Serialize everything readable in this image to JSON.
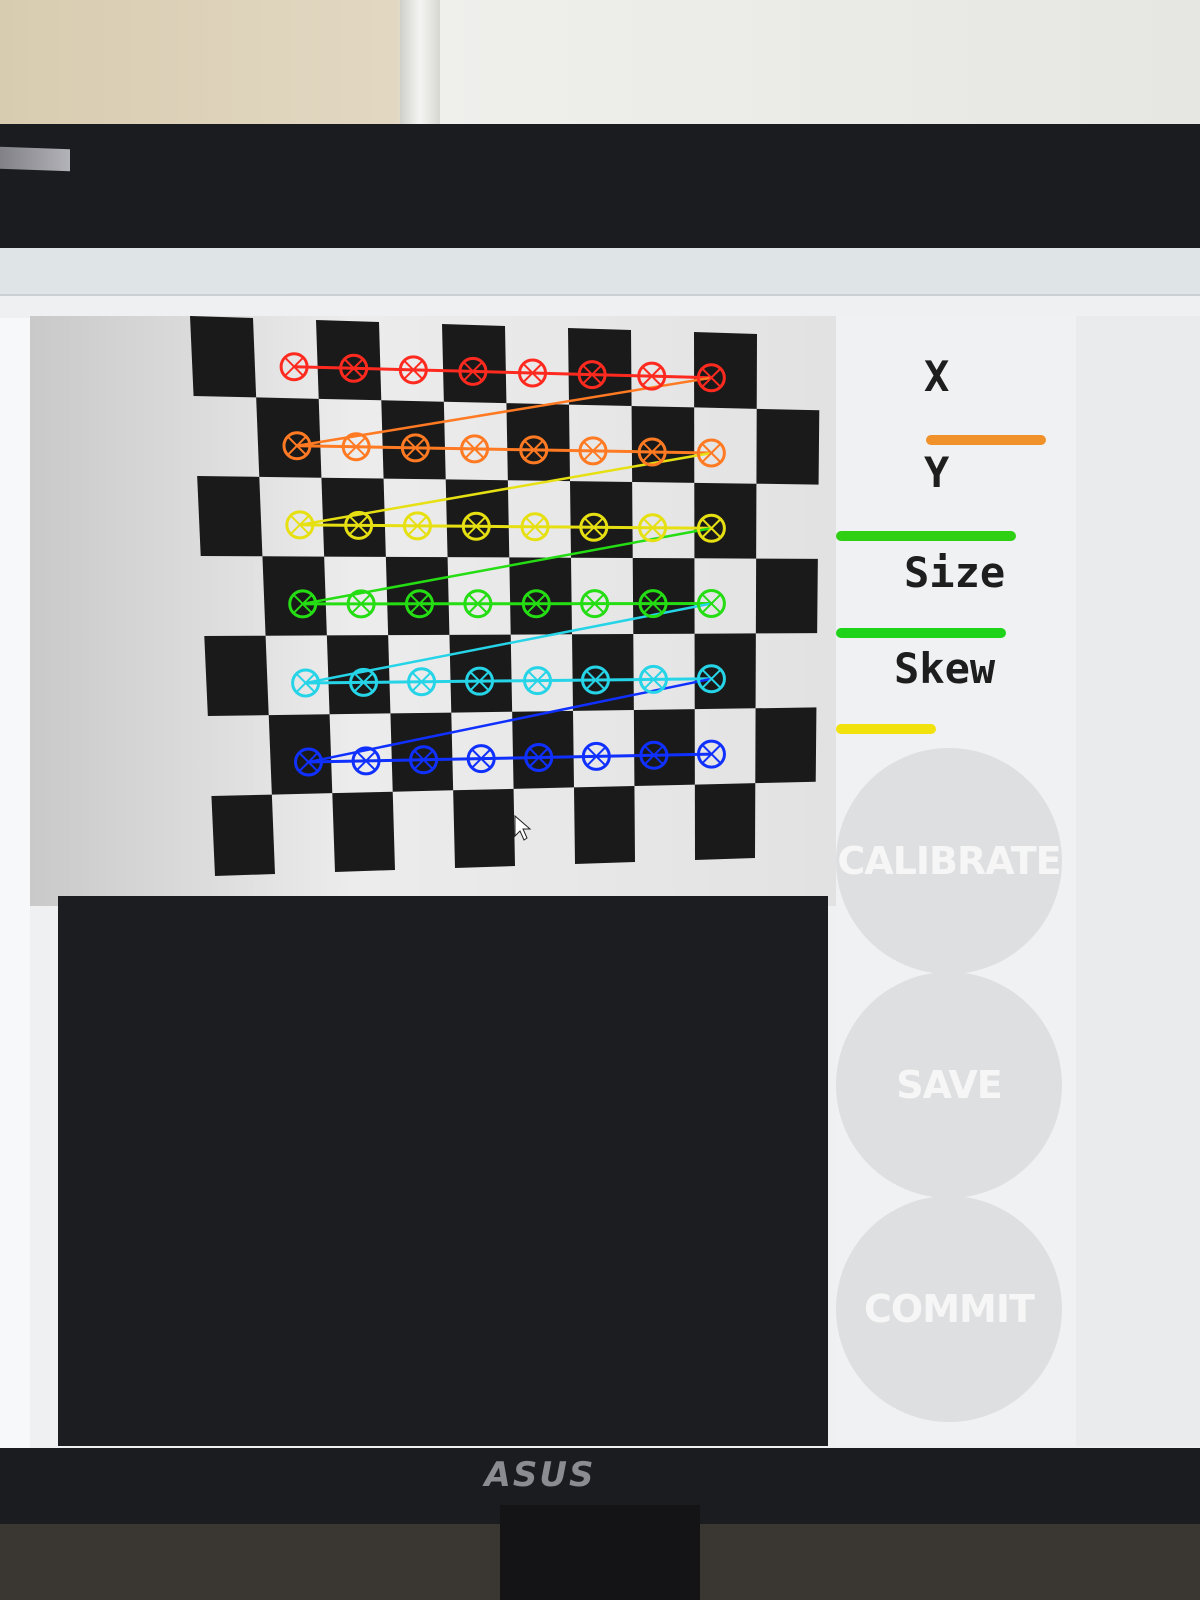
{
  "panel": {
    "metrics": [
      {
        "label": "X",
        "level": 0,
        "color": ""
      },
      {
        "label": "Y",
        "level": 1.0,
        "color": "#f0912a"
      },
      {
        "label": "Size",
        "level": 0.85,
        "color": "#2fcf14"
      },
      {
        "label": "Skew",
        "level": 0.75,
        "color": "#1fd21a"
      },
      {
        "label": "",
        "level": 0.45,
        "color": "#f1e20c"
      }
    ],
    "buttons": {
      "calibrate": "CALIBRATE",
      "save": "SAVE",
      "commit": "COMMIT"
    }
  },
  "bezel": {
    "logo": "ASUS"
  },
  "detection": {
    "row_colors": [
      "#ff2a1f",
      "#ff7a22",
      "#e6e013",
      "#25dd13",
      "#26d4e8",
      "#1030ff"
    ]
  },
  "cursor_icon": "mouse-pointer-icon"
}
